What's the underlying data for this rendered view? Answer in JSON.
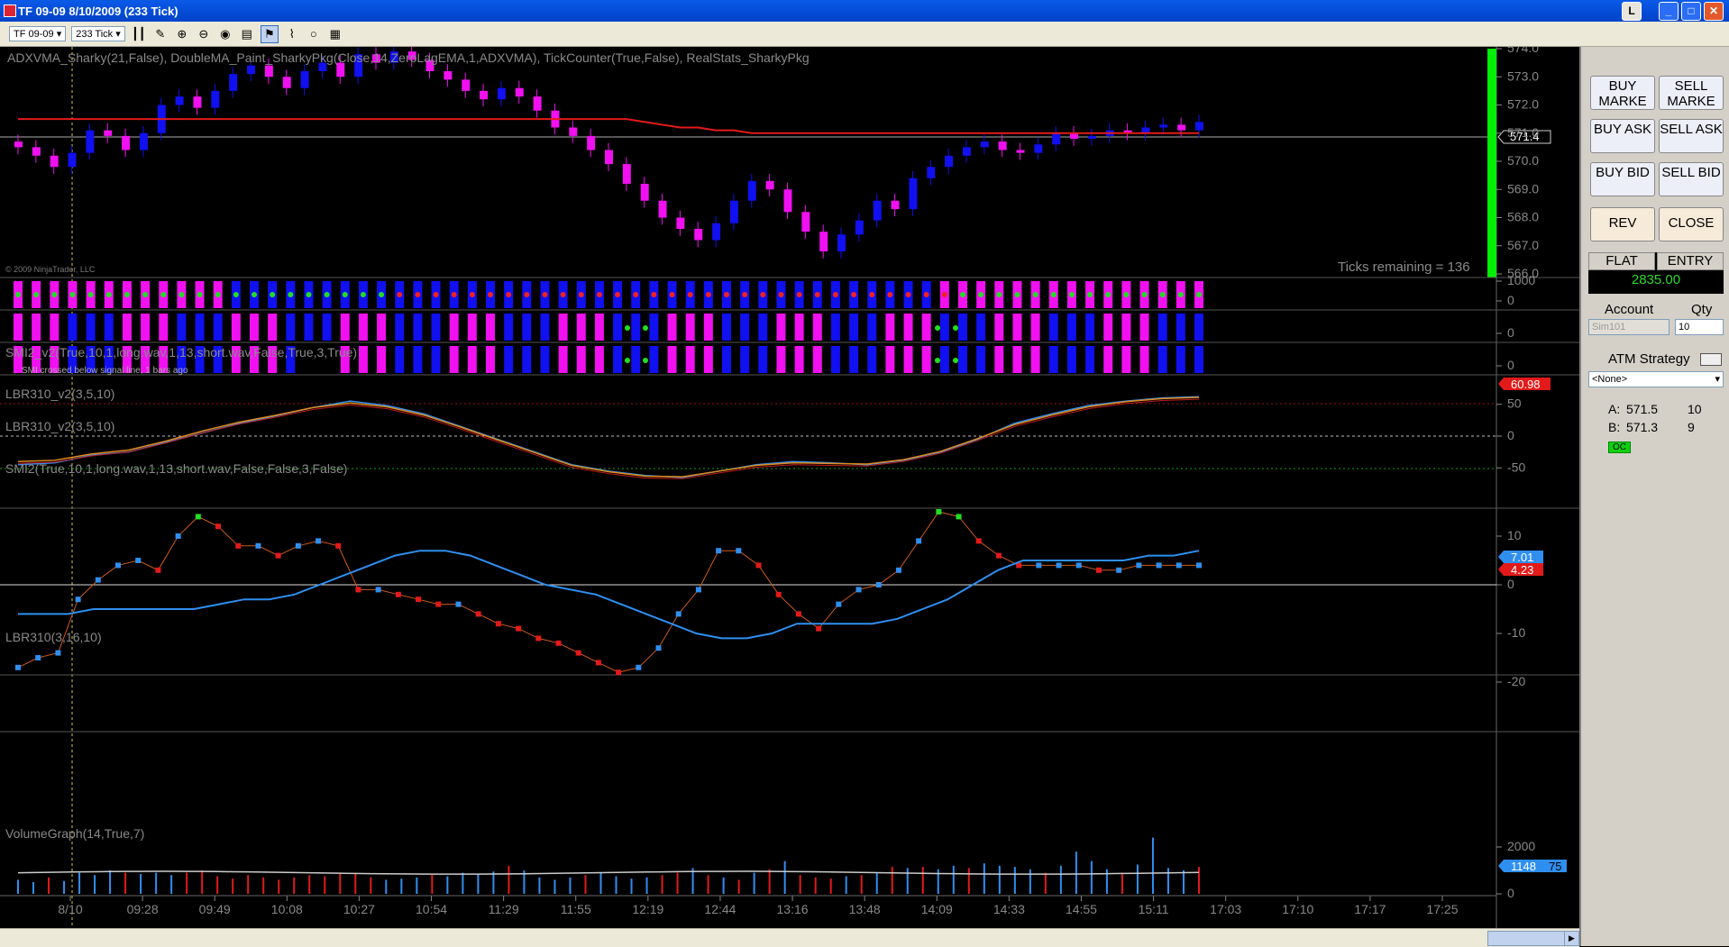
{
  "window": {
    "title": "TF 09-09  8/10/2009 (233 Tick)",
    "buttons": [
      "_",
      "□",
      "✕"
    ],
    "l_button": "L"
  },
  "toolbar": {
    "instrument": "TF 09-09",
    "interval": "233 Tick"
  },
  "chart": {
    "copyright": "© 2009 NinjaTrader, LLC",
    "ticks_remaining": "Ticks remaining = 136",
    "main_label": "ADXVMA_Sharky(21,False),  DoubleMA_Paint_SharkyPkg(Close,14,ZeroLagEMA,1,ADXVMA),  TickCounter(True,False),  RealStats_SharkyPkg",
    "last_price": "571.4",
    "price_ticks": [
      "574.0",
      "573.0",
      "572.0",
      "571.0",
      "570.0",
      "569.0",
      "568.0",
      "567.0",
      "566.0"
    ],
    "price_range": [
      566.0,
      574.0
    ],
    "price_colors": {
      "up": "#1010f0",
      "down": "#f010f0",
      "ma": "#e31a1a"
    },
    "smi_bar_label": "SMI2_v2(True,10,1,long.wav,1,13,short.wav,False,True,3,True)",
    "smi_bar_note": "SMI crossed below signal line, 1 bars ago",
    "smi_bar_ticks": [
      "1000",
      "0"
    ],
    "lbr1_label": "LBR310_v2(3,5,10)",
    "lbr1_ticks": [
      "0"
    ],
    "lbr2_label": "LBR310_v2(3,5,10)",
    "lbr2_ticks": [
      "0"
    ],
    "smi_label": "SMI2(True,10,1,long.wav,1,13,short.wav,False,False,3,False)",
    "smi_value": "60.98",
    "smi_ticks": [
      "50",
      "0",
      "-50"
    ],
    "lbr_label": "LBR310(3,16,10)",
    "lbr_values": [
      "7.01",
      "4.23"
    ],
    "lbr_ticks": [
      "10",
      "0",
      "-10",
      "-20"
    ],
    "vol_label": "VolumeGraph(14,True,7)",
    "vol_value": "1148",
    "vol_value_suffix": "75",
    "vol_ticks": [
      "2000",
      "0"
    ],
    "time_labels": [
      "8/10",
      "09:28",
      "09:49",
      "10:08",
      "10:27",
      "10:54",
      "11:29",
      "11:55",
      "12:19",
      "12:44",
      "13:16",
      "13:48",
      "14:09",
      "14:33",
      "14:55",
      "15:11",
      "17:03",
      "17:10",
      "17:17",
      "17:25"
    ]
  },
  "chart_data": {
    "type": "candlestick",
    "title": "TF 09-09 8/10/2009 (233 Tick)",
    "ylim": [
      566.0,
      574.0
    ],
    "close": [
      570.5,
      570.2,
      569.8,
      570.3,
      571.1,
      570.9,
      570.4,
      571.0,
      572.0,
      572.3,
      571.9,
      572.5,
      573.1,
      573.4,
      573.0,
      572.6,
      573.2,
      573.5,
      573.0,
      573.8,
      573.5,
      573.9,
      573.6,
      573.2,
      572.9,
      572.5,
      572.2,
      572.6,
      572.3,
      571.8,
      571.2,
      570.9,
      570.4,
      569.9,
      569.2,
      568.6,
      568.0,
      567.6,
      567.2,
      567.8,
      568.6,
      569.3,
      569.0,
      568.2,
      567.5,
      566.8,
      567.4,
      567.9,
      568.6,
      568.3,
      569.4,
      569.8,
      570.2,
      570.5,
      570.7,
      570.4,
      570.3,
      570.6,
      571.0,
      570.8,
      570.9,
      571.1,
      571.0,
      571.2,
      571.3,
      571.1,
      571.4
    ],
    "ma": [
      571.5,
      571.5,
      571.5,
      571.5,
      571.5,
      571.5,
      571.5,
      571.5,
      571.5,
      571.5,
      571.5,
      571.5,
      571.5,
      571.5,
      571.5,
      571.5,
      571.5,
      571.5,
      571.5,
      571.5,
      571.5,
      571.5,
      571.5,
      571.5,
      571.5,
      571.5,
      571.5,
      571.5,
      571.5,
      571.5,
      571.5,
      571.5,
      571.5,
      571.5,
      571.5,
      571.4,
      571.3,
      571.2,
      571.2,
      571.1,
      571.1,
      571.0,
      571.0,
      571.0,
      571.0,
      571.0,
      571.0,
      571.0,
      571.0,
      571.0,
      571.0,
      571.0,
      571.0,
      571.0,
      571.0,
      571.0,
      571.0,
      571.0,
      571.0,
      571.0,
      571.0,
      571.0,
      571.0,
      571.0,
      571.0,
      571.0,
      571.0
    ],
    "smi": [
      -45,
      -42,
      -30,
      -25,
      -10,
      5,
      20,
      32,
      45,
      55,
      48,
      35,
      15,
      -5,
      -25,
      -45,
      -55,
      -62,
      -65,
      -55,
      -45,
      -40,
      -42,
      -45,
      -38,
      -25,
      -5,
      20,
      35,
      48,
      55,
      60,
      62
    ],
    "smi_signal": [
      -40,
      -38,
      -28,
      -22,
      -8,
      8,
      22,
      33,
      45,
      52,
      46,
      33,
      14,
      -6,
      -26,
      -46,
      -56,
      -63,
      -64,
      -55,
      -46,
      -42,
      -43,
      -44,
      -37,
      -24,
      -4,
      18,
      33,
      46,
      54,
      59,
      61
    ],
    "lbr_fast": [
      -17,
      -15,
      -14,
      -3,
      1,
      4,
      5,
      3,
      10,
      14,
      12,
      8,
      8,
      6,
      8,
      9,
      8,
      -1,
      -1,
      -2,
      -3,
      -4,
      -4,
      -6,
      -8,
      -9,
      -11,
      -12,
      -14,
      -16,
      -18,
      -17,
      -13,
      -6,
      -1,
      7,
      7,
      4,
      -2,
      -6,
      -9,
      -4,
      -1,
      0,
      3,
      9,
      15,
      14,
      9,
      6,
      4,
      4,
      4,
      4,
      3,
      3,
      4,
      4,
      4,
      4
    ],
    "lbr_slow": [
      -6,
      -6,
      -6,
      -5,
      -5,
      -5,
      -5,
      -5,
      -4,
      -3,
      -3,
      -2,
      0,
      2,
      4,
      6,
      7,
      7,
      6,
      4,
      2,
      0,
      -1,
      -2,
      -4,
      -6,
      -8,
      -10,
      -11,
      -11,
      -10,
      -8,
      -8,
      -8,
      -8,
      -7,
      -5,
      -3,
      0,
      3,
      5,
      5,
      5,
      5,
      5,
      6,
      6,
      7
    ],
    "volume": [
      600,
      500,
      700,
      550,
      900,
      800,
      1000,
      900,
      850,
      900,
      800,
      900,
      1000,
      750,
      650,
      800,
      700,
      600,
      700,
      800,
      750,
      900,
      850,
      700,
      600,
      650,
      700,
      800,
      750,
      900,
      850,
      950,
      1200,
      1000,
      700,
      600,
      700,
      800,
      900,
      750,
      650,
      700,
      800,
      900,
      1100,
      800,
      700,
      600,
      900,
      1050,
      1400,
      800,
      700,
      650,
      750,
      800,
      900,
      1150,
      1100,
      1150,
      1050,
      1200,
      1100,
      1300,
      1200,
      1150,
      1050,
      900,
      1200,
      1800,
      1400,
      1050,
      900,
      1250,
      2400,
      1100,
      1000,
      1148
    ]
  },
  "side": {
    "buy_market": "BUY MARKE",
    "sell_market": "SELL MARKE",
    "buy_ask": "BUY ASK",
    "sell_ask": "SELL ASK",
    "buy_bid": "BUY BID",
    "sell_bid": "SELL BID",
    "rev": "REV",
    "close": "CLOSE",
    "flat": "FLAT",
    "entry": "ENTRY",
    "pnl": "2835.00",
    "account_label": "Account",
    "qty_label": "Qty",
    "account_value": "Sim101",
    "qty_value": "10",
    "atm_label": "ATM Strategy",
    "atm_value": "<None>",
    "ask_label": "A:",
    "ask_price": "571.5",
    "ask_size": "10",
    "bid_label": "B:",
    "bid_price": "571.3",
    "bid_size": "9",
    "oc": "OC"
  }
}
